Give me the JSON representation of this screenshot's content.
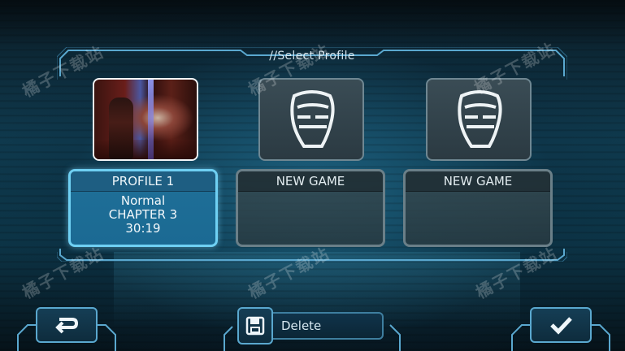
{
  "screen": {
    "title": "//Select Profile"
  },
  "profiles": [
    {
      "state": "active",
      "header": "PROFILE 1",
      "difficulty": "Normal",
      "chapter": "CHAPTER 3",
      "time": "30:19"
    },
    {
      "state": "empty",
      "header": "NEW GAME"
    },
    {
      "state": "empty",
      "header": "NEW GAME"
    }
  ],
  "controls": {
    "back_icon": "return-arrow-icon",
    "delete_icon": "floppy-disk-icon",
    "delete_label": "Delete",
    "confirm_icon": "checkmark-icon"
  },
  "watermarks": [
    "橘子下载站",
    "橘子下载站",
    "橘子下载站",
    "橘子下载站",
    "橘子下载站",
    "橘子下载站",
    "橘子下载站"
  ],
  "colors": {
    "accent": "#6fd0f3",
    "active_card": "#1f6f98",
    "empty_card": "#37494f"
  }
}
